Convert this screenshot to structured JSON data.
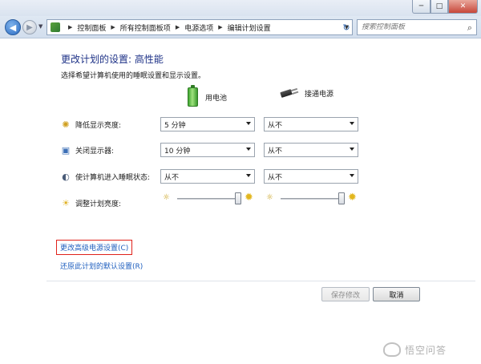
{
  "window": {
    "min": "─",
    "max": "□",
    "close": "✕"
  },
  "address": {
    "crumbs": [
      "控制面板",
      "所有控制面板项",
      "电源选项",
      "编辑计划设置"
    ],
    "search_placeholder": "搜索控制面板"
  },
  "page": {
    "title": "更改计划的设置: 高性能",
    "subtitle": "选择希望计算机使用的睡眠设置和显示设置。"
  },
  "columns": {
    "battery": "用电池",
    "plugged": "接通电源"
  },
  "rows": [
    {
      "label": "降低显示亮度:",
      "icon": "dim-display-icon",
      "battery": "5 分钟",
      "plugged": "从不"
    },
    {
      "label": "关闭显示器:",
      "icon": "monitor-icon",
      "battery": "10 分钟",
      "plugged": "从不"
    },
    {
      "label": "使计算机进入睡眠状态:",
      "icon": "sleep-icon",
      "battery": "从不",
      "plugged": "从不"
    }
  ],
  "brightness": {
    "label": "调整计划亮度:",
    "battery_level": 1.0,
    "plugged_level": 1.0
  },
  "links": {
    "advanced": "更改高级电源设置(C)",
    "restore": "还原此计划的默认设置(R)"
  },
  "buttons": {
    "save": "保存修改",
    "cancel": "取消"
  },
  "watermark": "悟空问答",
  "colors": {
    "title": "#1e3287",
    "link": "#1f5fbf",
    "highlight_box": "#e0221b"
  }
}
